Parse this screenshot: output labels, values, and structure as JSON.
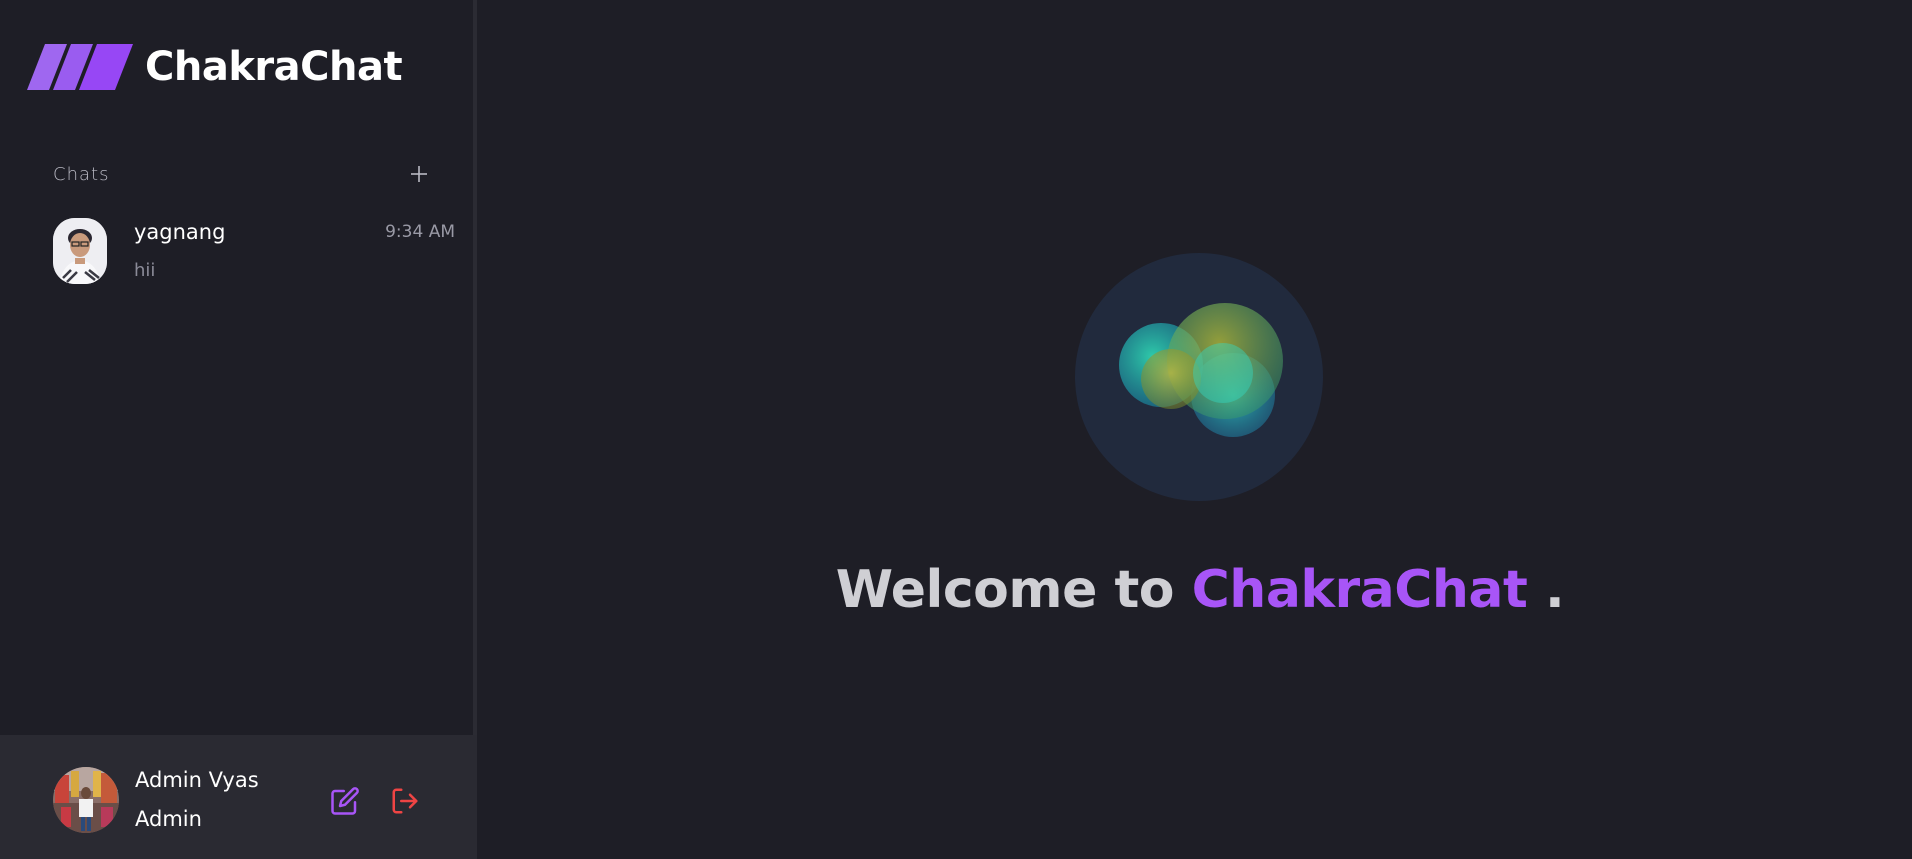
{
  "app": {
    "brand_name": "ChakraChat",
    "accent_color": "#a855f7"
  },
  "sidebar": {
    "chats_title": "Chats",
    "add_icon": "plus-icon",
    "chats": [
      {
        "name": "yagnang",
        "time": "9:34 AM",
        "preview": "hii"
      }
    ],
    "profile": {
      "name": "Admin Vyas",
      "role": "Admin",
      "edit_icon": "edit-icon",
      "logout_icon": "logout-icon"
    }
  },
  "main": {
    "welcome_prefix": "Welcome to",
    "welcome_brand": "ChakraChat",
    "welcome_suffix": "."
  }
}
